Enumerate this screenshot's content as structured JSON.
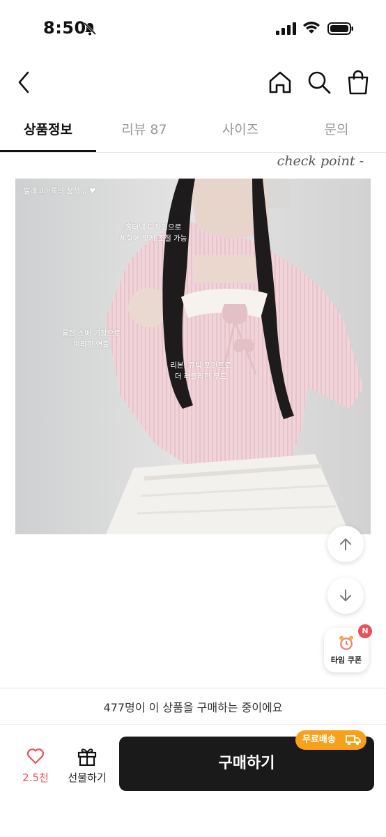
{
  "status_bar": {
    "time": "8:50"
  },
  "tabs": [
    {
      "label": "상품정보"
    },
    {
      "label": "리뷰 87"
    },
    {
      "label": "사이즈"
    },
    {
      "label": "문의"
    }
  ],
  "content": {
    "check_point": "check point -",
    "overlay": {
      "tag": "발레코어룩의 정석 ,, ♥",
      "text1_line1": "홀터넥 디자인으로",
      "text1_line2": "체형에 맞게 조절 가능",
      "text2_line1": "롱한 소매 기장으로",
      "text2_line2": "여리핏 연출",
      "text3_line1": "리본, 큐빅 포인트로",
      "text3_line2": "더 러블리한 무드"
    }
  },
  "floating": {
    "coupon_label": "타임 쿠폰",
    "badge": "N"
  },
  "bottom": {
    "buyers_text": "477명이 이 상품을 구매하는 중이에요",
    "like_count": "2.5천",
    "gift_label": "선물하기",
    "buy_label": "구매하기",
    "shipping_badge": "무료배송"
  },
  "colors": {
    "accent_red": "#e8505b",
    "shipping_orange": "#f7a11b",
    "buy_button": "#1a1a1a"
  }
}
